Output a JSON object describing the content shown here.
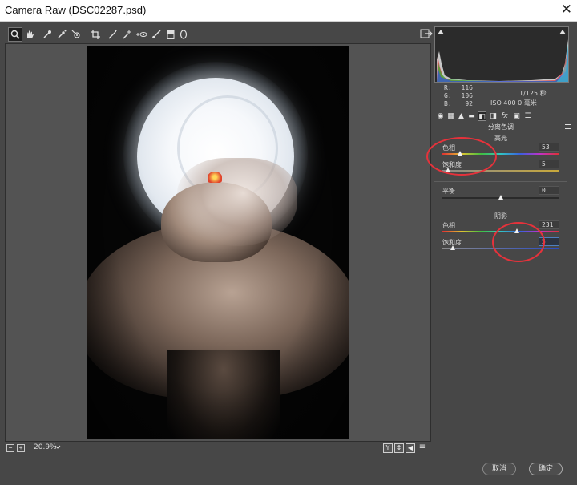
{
  "window": {
    "title": "Camera Raw (DSC02287.psd)",
    "close_glyph": "✕"
  },
  "toolbar": {
    "tools": [
      "zoom-tool",
      "hand-tool",
      "white-balance-tool",
      "color-sampler-tool",
      "targeted-adjustment-tool",
      "crop-tool",
      "straighten-tool",
      "spot-removal-tool",
      "red-eye-tool",
      "adjustment-brush",
      "graduated-filter",
      "radial-filter"
    ],
    "active_tool": "zoom-tool"
  },
  "zoom": {
    "level": "20.9%",
    "out_glyph": "−",
    "in_glyph": "+"
  },
  "view_buttons": [
    "Y",
    "↕",
    "◀",
    "≡"
  ],
  "histogram": {
    "readout": [
      {
        "label": "R:",
        "value": "116"
      },
      {
        "label": "G:",
        "value": "106"
      },
      {
        "label": "B:",
        "value": "92"
      }
    ],
    "camera": {
      "line1": "1/125 秒",
      "line2": "ISO 400  0 毫米"
    }
  },
  "panel_tabs": [
    "◉",
    "▦",
    "▲",
    "▬",
    "◧",
    "◨",
    "fx",
    "▣",
    "☰"
  ],
  "split_toning": {
    "title": "分离色调",
    "highlights": {
      "title": "高光",
      "hue": {
        "label": "色相",
        "value": "53",
        "pct": 0.15
      },
      "saturation": {
        "label": "饱和度",
        "value": "5",
        "pct": 0.05
      }
    },
    "balance": {
      "label": "平衡",
      "value": "0",
      "pct": 0.5
    },
    "shadows": {
      "title": "阴影",
      "hue": {
        "label": "色相",
        "value": "231",
        "pct": 0.64
      },
      "saturation": {
        "label": "饱和度",
        "value": "5",
        "pct": 0.09
      }
    }
  },
  "footer": {
    "cancel_label": "取消",
    "ok_label": "确定"
  },
  "colors": {
    "annotation": "#e6323b",
    "focus": "#4d7fbf"
  }
}
